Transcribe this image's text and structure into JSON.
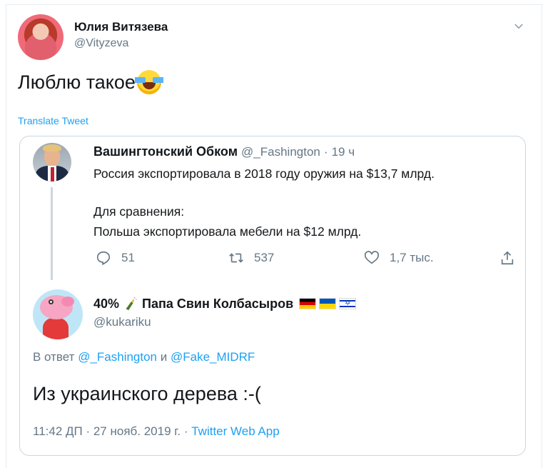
{
  "author": {
    "name": "Юлия Витязева",
    "handle": "@Vityzeva"
  },
  "tweet": {
    "text": "Люблю такое",
    "emoji": "face-with-tears-of-joy-icon",
    "translate_label": "Translate Tweet"
  },
  "quoted": {
    "name": "Вашингтонский Обком",
    "handle": "@_Fashington",
    "separator": "·",
    "time": "19 ч",
    "line1": "Россия экспортировала в 2018 году оружия на $13,7 млрд.",
    "line2": "Для сравнения:",
    "line3": "Польша экспортировала мебели на $12 млрд.",
    "replies": "51",
    "retweets": "537",
    "likes": "1,7 тыс."
  },
  "reply": {
    "name_prefix": "40%",
    "name_main": "Папа Свин Колбасыров",
    "handle": "@kukariku",
    "reply_to_prefix": "В ответ",
    "reply_to_user1": "@_Fashington",
    "reply_to_and": "и",
    "reply_to_user2": "@Fake_MIDRF",
    "text": "Из украинского дерева :-(",
    "timestamp": "11:42 ДП · 27 нояб. 2019 г. ·",
    "source": "Twitter Web App"
  },
  "colors": {
    "link": "#1da1f2",
    "muted": "#657786",
    "text": "#14171a",
    "border": "#ccd6dd"
  }
}
